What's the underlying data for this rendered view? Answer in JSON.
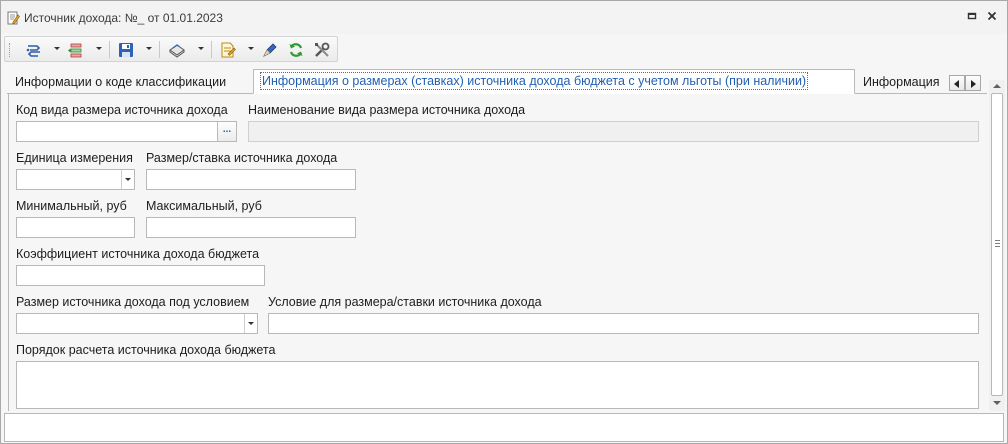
{
  "window": {
    "title": "Источник дохода: №_ от 01.01.2023"
  },
  "toolbar": {
    "buttons": [
      {
        "icon": "navigate-icon",
        "has_dropdown": true
      },
      {
        "icon": "list-actions-icon",
        "has_dropdown": true
      },
      {
        "icon": "save-icon",
        "has_dropdown": true
      },
      {
        "icon": "print-icon",
        "has_dropdown": true
      },
      {
        "icon": "document-icon",
        "has_dropdown": true
      },
      {
        "icon": "edit-pen-icon",
        "has_dropdown": false
      },
      {
        "icon": "refresh-icon",
        "has_dropdown": false
      },
      {
        "icon": "tools-icon",
        "has_dropdown": false
      }
    ]
  },
  "tabs": [
    {
      "label": "Информации о коде классификации",
      "active": false
    },
    {
      "label": "Информация о размерах (ставках) источника дохода бюджета с учетом льготы (при наличии)",
      "active": true
    },
    {
      "label": "Информация",
      "active": false
    }
  ],
  "form": {
    "income_type_code": {
      "label": "Код вида размера источника дохода",
      "value": "",
      "button": "..."
    },
    "income_type_name": {
      "label": "Наименование вида размера источника дохода",
      "value": ""
    },
    "unit": {
      "label": "Единица измерения",
      "value": ""
    },
    "rate": {
      "label": "Размер/ставка источника дохода",
      "value": ""
    },
    "min": {
      "label": "Минимальный, руб",
      "value": ""
    },
    "max": {
      "label": "Максимальный, руб",
      "value": ""
    },
    "coefficient": {
      "label": "Коэффициент источника дохода бюджета",
      "value": ""
    },
    "conditional_size": {
      "label": "Размер источника дохода под условием",
      "value": ""
    },
    "condition": {
      "label": "Условие для размера/ставки источника дохода",
      "value": ""
    },
    "calc_order": {
      "label": "Порядок расчета источника дохода бюджета",
      "value": ""
    }
  },
  "colors": {
    "active_tab_text": "#1f5fb3",
    "window_bg": "#f6f6f6",
    "border": "#b8b8b8"
  }
}
